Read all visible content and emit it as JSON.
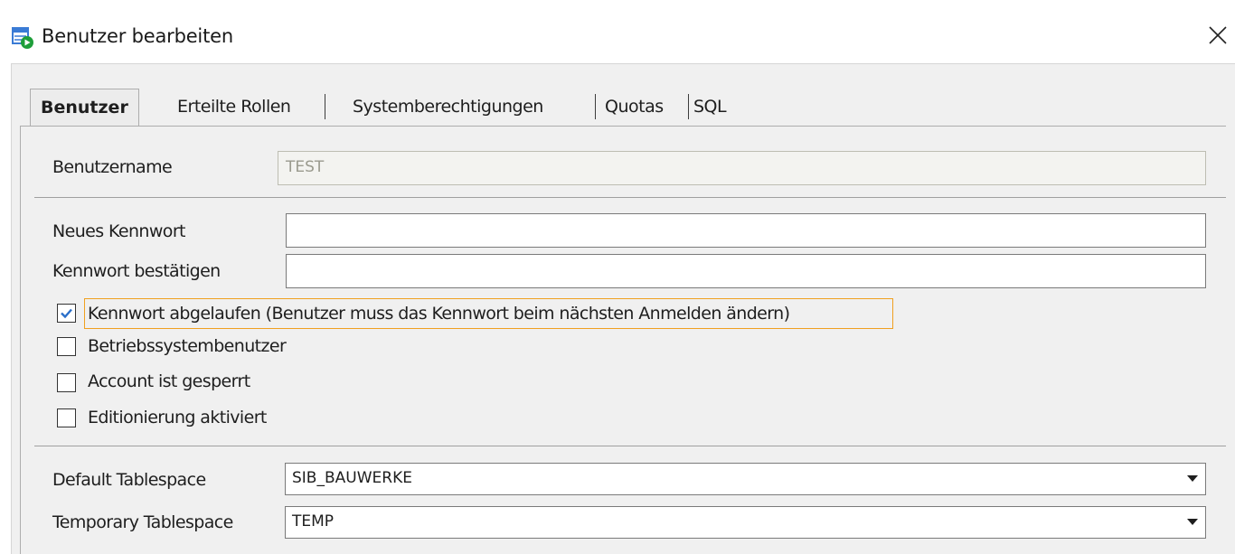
{
  "window": {
    "title": "Benutzer bearbeiten",
    "icon": "user-edit-icon",
    "close_icon": "close-icon"
  },
  "tabs": [
    {
      "label": "Benutzer",
      "active": true
    },
    {
      "label": "Erteilte Rollen",
      "active": false
    },
    {
      "label": "Systemberechtigungen",
      "active": false
    },
    {
      "label": "Quotas",
      "active": false
    },
    {
      "label": "SQL",
      "active": false
    }
  ],
  "form": {
    "username_label": "Benutzername",
    "username_value": "TEST",
    "new_password_label": "Neues Kennwort",
    "new_password_value": "",
    "confirm_password_label": "Kennwort bestätigen",
    "confirm_password_value": "",
    "checkboxes": [
      {
        "label": "Kennwort abgelaufen (Benutzer muss das Kennwort beim nächsten Anmelden ändern)",
        "checked": true,
        "focused": true
      },
      {
        "label": "Betriebssystembenutzer",
        "checked": false
      },
      {
        "label": "Account ist gesperrt",
        "checked": false
      },
      {
        "label": "Editionierung aktiviert",
        "checked": false
      }
    ],
    "default_tablespace_label": "Default Tablespace",
    "default_tablespace_value": "SIB_BAUWERKE",
    "temporary_tablespace_label": "Temporary Tablespace",
    "temporary_tablespace_value": "TEMP"
  },
  "colors": {
    "checkbox_check": "#2a6fc9",
    "focus_ring": "#f0a020",
    "icon_green": "#1e9e3a",
    "icon_blue": "#3a7bd5"
  }
}
